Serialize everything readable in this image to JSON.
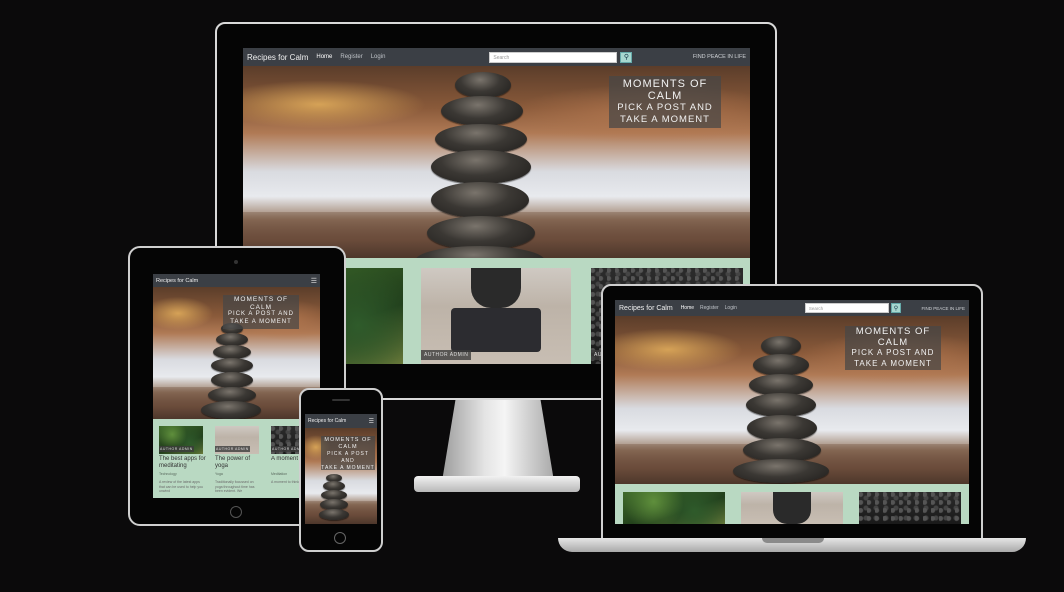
{
  "site": {
    "brand": "Recipes for Calm",
    "nav_links": [
      "Home",
      "Register",
      "Login"
    ],
    "search_placeholder": "Search",
    "tagline": "FIND PEACE IN LIFE"
  },
  "hero": {
    "line1": "MOMENTS OF",
    "line2": "CALM",
    "line3": "PICK A POST AND",
    "line4": "TAKE A MOMENT"
  },
  "cards": [
    {
      "author": "AUTHOR ADMIN",
      "title": "The best apps for meditating",
      "category": "Technology",
      "excerpt": "A review of the latest apps that can be used to help you unwind"
    },
    {
      "author": "AUTHOR ADMIN",
      "title": "The power of yoga",
      "category": "Yoga",
      "excerpt": "Traditionally focussed on yoga throughout time has been evident. We"
    },
    {
      "author": "AUTHOR ADMIN",
      "title": "A moment to breath",
      "category": "Meditation",
      "excerpt": "A moment to think"
    }
  ],
  "colors": {
    "page_bg": "#0b0a0b",
    "navbar": "#3b3f45",
    "content_bg": "#b9d9c2",
    "overlay": "#464646",
    "search_button": "#a7d8d0"
  }
}
